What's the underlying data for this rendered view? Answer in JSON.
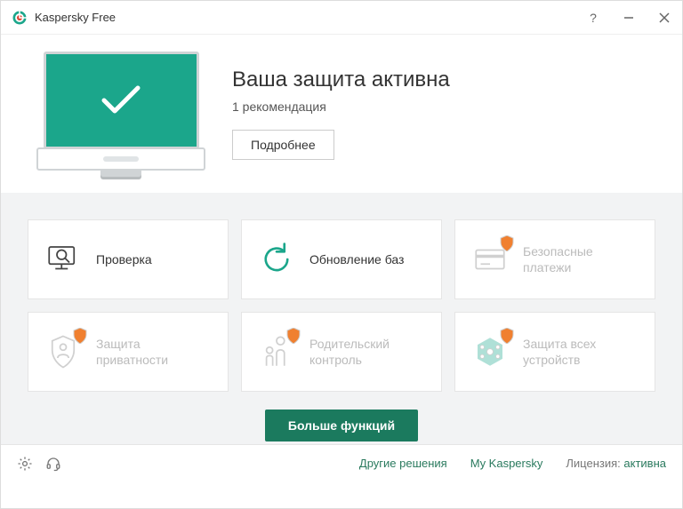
{
  "titlebar": {
    "app_name": "Kaspersky Free"
  },
  "hero": {
    "title": "Ваша защита активна",
    "subtitle": "1 рекомендация",
    "details_button": "Подробнее"
  },
  "tiles": [
    {
      "label": "Проверка",
      "enabled": true,
      "icon": "scan"
    },
    {
      "label": "Обновление баз",
      "enabled": true,
      "icon": "update"
    },
    {
      "label": "Безопасные платежи",
      "enabled": false,
      "icon": "payments",
      "badge": true
    },
    {
      "label": "Защита приватности",
      "enabled": false,
      "icon": "privacy",
      "badge": true
    },
    {
      "label": "Родительский контроль",
      "enabled": false,
      "icon": "parental",
      "badge": true
    },
    {
      "label": "Защита всех устройств",
      "enabled": false,
      "icon": "devices",
      "badge": true
    }
  ],
  "more_button": "Больше функций",
  "footer": {
    "other_solutions": "Другие решения",
    "my_kaspersky": "My Kaspersky",
    "license_label": "Лицензия:",
    "license_status": "активна"
  }
}
